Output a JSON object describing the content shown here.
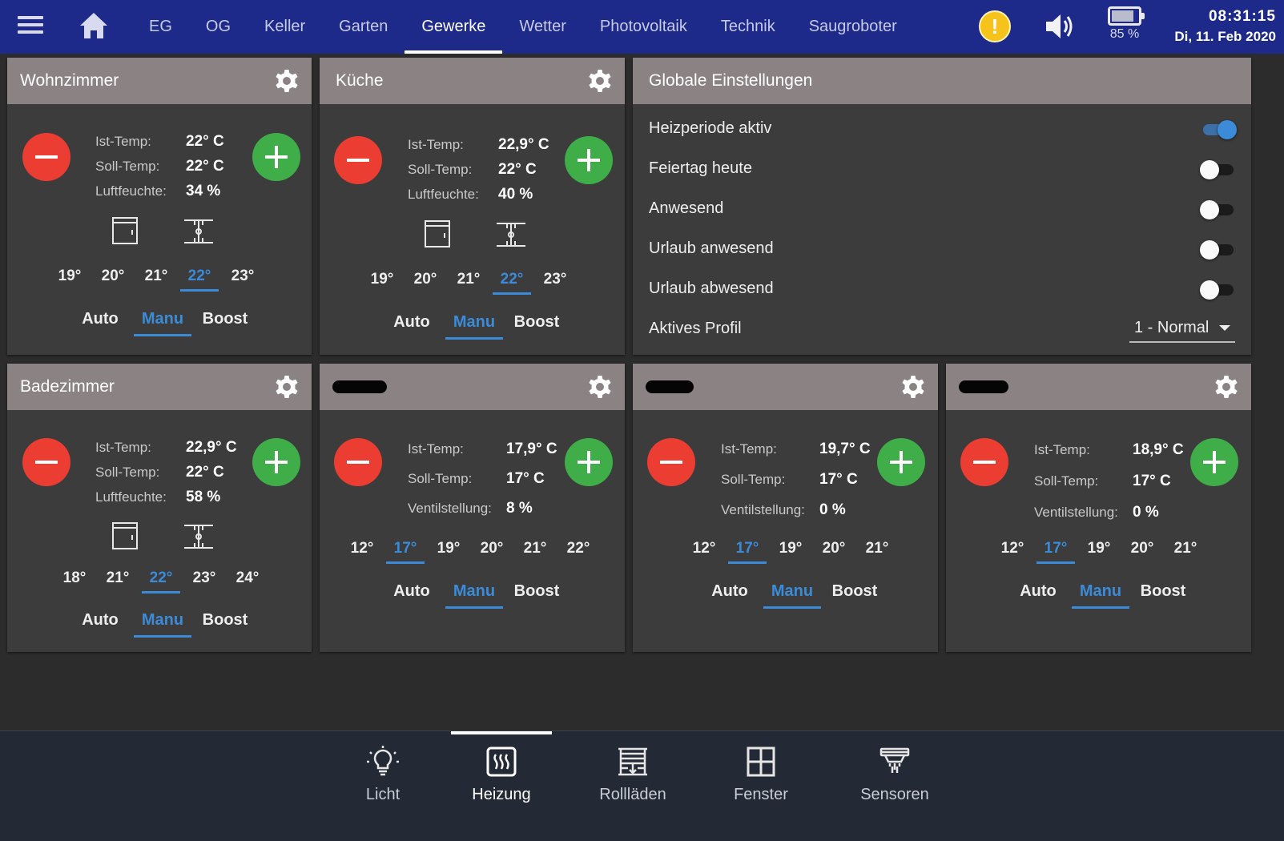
{
  "topbar": {
    "tabs": [
      {
        "label": "EG"
      },
      {
        "label": "OG"
      },
      {
        "label": "Keller"
      },
      {
        "label": "Garten"
      },
      {
        "label": "Gewerke",
        "active": true
      },
      {
        "label": "Wetter"
      },
      {
        "label": "Photovoltaik"
      },
      {
        "label": "Technik"
      },
      {
        "label": "Saugroboter"
      }
    ],
    "warning_glyph": "!",
    "battery_label": "85 %",
    "battery_level": 0.85,
    "time": "08:31:15",
    "date": "Di, 11. Feb 2020"
  },
  "colors": {
    "topbar": "#1e2a8a",
    "card_header": "#8a8283",
    "card_body": "#3c3c3c",
    "accent": "#3b8bd9",
    "minus": "#ec3d33",
    "plus": "#3fae49",
    "warning": "#f6c21c"
  },
  "rooms": [
    {
      "title": "Wohnzimmer",
      "rows": [
        {
          "label": "Ist-Temp:",
          "value": "22° C"
        },
        {
          "label": "Soll-Temp:",
          "value": "22° C"
        },
        {
          "label": "Luftfeuchte:",
          "value": "34 %"
        }
      ],
      "temps": [
        "19°",
        "20°",
        "21°",
        "22°",
        "23°"
      ],
      "modes": [
        "Auto",
        "Manu",
        "Boost"
      ]
    },
    {
      "title": "Küche",
      "rows": [
        {
          "label": "Ist-Temp:",
          "value": "22,9° C"
        },
        {
          "label": "Soll-Temp:",
          "value": "22° C"
        },
        {
          "label": "Luftfeuchte:",
          "value": "40 %"
        }
      ],
      "temps": [
        "19°",
        "20°",
        "21°",
        "22°",
        "23°"
      ],
      "modes": [
        "Auto",
        "Manu",
        "Boost"
      ]
    },
    {
      "title": "Badezimmer",
      "rows": [
        {
          "label": "Ist-Temp:",
          "value": "22,9° C"
        },
        {
          "label": "Soll-Temp:",
          "value": "22° C"
        },
        {
          "label": "Luftfeuchte:",
          "value": "58 %"
        }
      ],
      "temps": [
        "18°",
        "21°",
        "22°",
        "23°",
        "24°"
      ],
      "modes": [
        "Auto",
        "Manu",
        "Boost"
      ]
    },
    {
      "title": "",
      "rows": [
        {
          "label": "Ist-Temp:",
          "value": "17,9° C"
        },
        {
          "label": "Soll-Temp:",
          "value": "17° C"
        },
        {
          "label": "Ventilstellung:",
          "value": "8 %"
        }
      ],
      "temps": [
        "12°",
        "17°",
        "19°",
        "20°",
        "21°",
        "22°"
      ],
      "modes": [
        "Auto",
        "Manu",
        "Boost"
      ]
    },
    {
      "title": "",
      "rows": [
        {
          "label": "Ist-Temp:",
          "value": "19,7° C"
        },
        {
          "label": "Soll-Temp:",
          "value": "17° C"
        },
        {
          "label": "Ventilstellung:",
          "value": "0 %"
        }
      ],
      "temps": [
        "12°",
        "17°",
        "19°",
        "20°",
        "21°"
      ],
      "modes": [
        "Auto",
        "Manu",
        "Boost"
      ]
    },
    {
      "title": "",
      "rows": [
        {
          "label": "Ist-Temp:",
          "value": "18,9° C"
        },
        {
          "label": "Soll-Temp:",
          "value": "17° C"
        },
        {
          "label": "Ventilstellung:",
          "value": "0 %"
        }
      ],
      "temps": [
        "12°",
        "17°",
        "19°",
        "20°",
        "21°"
      ],
      "modes": [
        "Auto",
        "Manu",
        "Boost"
      ]
    }
  ],
  "global": {
    "title": "Globale Einstellungen",
    "toggles": [
      {
        "label": "Heizperiode aktiv",
        "on": true
      },
      {
        "label": "Feiertag heute",
        "on": false
      },
      {
        "label": "Anwesend",
        "on": false
      },
      {
        "label": "Urlaub anwesend",
        "on": false
      },
      {
        "label": "Urlaub abwesend",
        "on": false
      }
    ],
    "profile_label": "Aktives Profil",
    "profile_value": "1 - Normal"
  },
  "bottom_nav": [
    {
      "label": "Licht",
      "icon": "bulb-icon"
    },
    {
      "label": "Heizung",
      "icon": "heating-icon",
      "active": true
    },
    {
      "label": "Rollläden",
      "icon": "shutter-icon"
    },
    {
      "label": "Fenster",
      "icon": "window-icon"
    },
    {
      "label": "Sensoren",
      "icon": "sensor-icon"
    }
  ]
}
